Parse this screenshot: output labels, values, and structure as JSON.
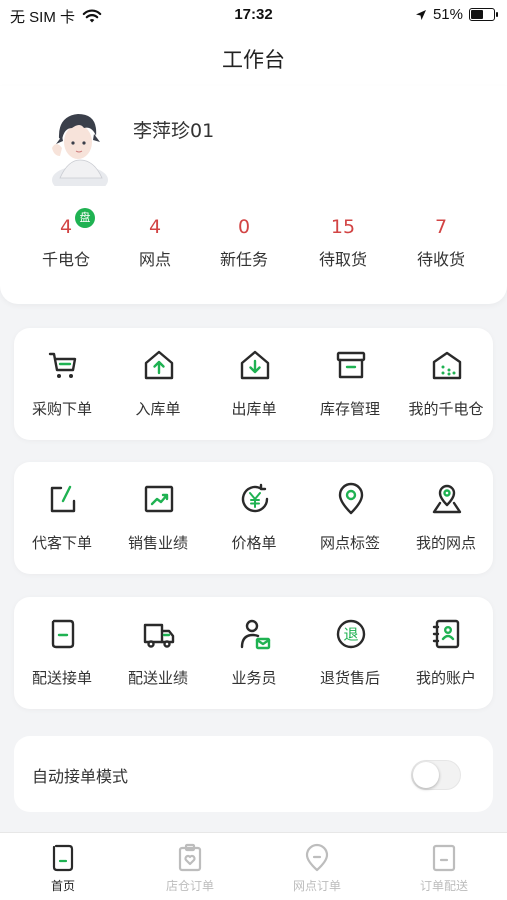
{
  "status_bar": {
    "carrier": "无 SIM 卡",
    "time": "17:32",
    "battery": "51%"
  },
  "nav": {
    "title": "工作台"
  },
  "profile": {
    "name": "李萍珍01"
  },
  "stats": [
    {
      "value": "4",
      "label": "千电仓",
      "badge": "盘"
    },
    {
      "value": "4",
      "label": "网点"
    },
    {
      "value": "0",
      "label": "新任务"
    },
    {
      "value": "15",
      "label": "待取货"
    },
    {
      "value": "7",
      "label": "待收货"
    }
  ],
  "grid1": [
    {
      "label": "采购下单",
      "icon": "cart-icon"
    },
    {
      "label": "入库单",
      "icon": "house-in-icon"
    },
    {
      "label": "出库单",
      "icon": "house-out-icon"
    },
    {
      "label": "库存管理",
      "icon": "box-icon"
    },
    {
      "label": "我的千电仓",
      "icon": "warehouse-icon"
    }
  ],
  "grid2": [
    {
      "label": "代客下单",
      "icon": "edit-icon"
    },
    {
      "label": "销售业绩",
      "icon": "chart-icon"
    },
    {
      "label": "价格单",
      "icon": "yen-icon"
    },
    {
      "label": "网点标签",
      "icon": "pin-icon"
    },
    {
      "label": "我的网点",
      "icon": "map-pin-icon"
    }
  ],
  "grid3": [
    {
      "label": "配送接单",
      "icon": "doc-icon"
    },
    {
      "label": "配送业绩",
      "icon": "truck-icon"
    },
    {
      "label": "业务员",
      "icon": "person-mail-icon"
    },
    {
      "label": "退货售后",
      "icon": "return-icon",
      "glyph": "退"
    },
    {
      "label": "我的账户",
      "icon": "account-book-icon"
    }
  ],
  "auto_mode": {
    "label": "自动接单模式",
    "enabled": false
  },
  "tabs": [
    {
      "label": "首页",
      "active": true
    },
    {
      "label": "店仓订单",
      "active": false
    },
    {
      "label": "网点订单",
      "active": false
    },
    {
      "label": "订单配送",
      "active": false
    }
  ],
  "colors": {
    "accent_green": "#1fb252",
    "stat_red": "#d24444",
    "icon_dark": "#2a2a2a"
  }
}
